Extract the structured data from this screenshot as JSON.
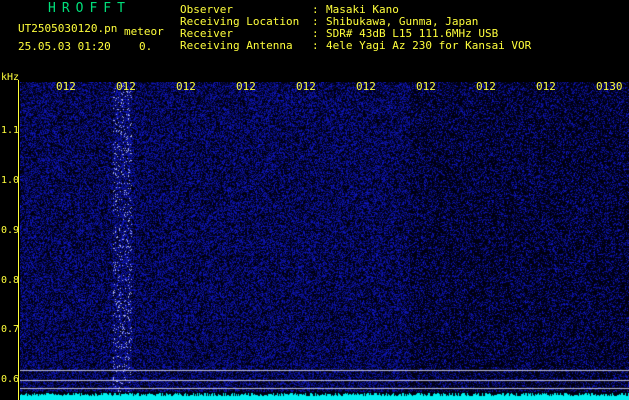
{
  "colors": {
    "title": "#00e07a",
    "text": "#ffff3c",
    "cyan": "#00f0f0",
    "bg": "#000000",
    "noise": "#1a24c8"
  },
  "header": {
    "app_title": "HROFFT",
    "filename": "UT2505030120.pn",
    "mode": "meteor",
    "date_time": "25.05.03 01:20",
    "value": "0.",
    "info": [
      {
        "label": "Observer",
        "value": "Masaki Kano"
      },
      {
        "label": "Receiving Location",
        "value": "Shibukawa, Gunma, Japan"
      },
      {
        "label": "Receiver",
        "value": "SDR# 43dB L15 111.6MHz USB"
      },
      {
        "label": "Receiving Antenna",
        "value": "4ele Yagi Az 230 for Kansai VOR"
      }
    ]
  },
  "axis": {
    "unit": "kHz",
    "time_ticks": [
      "012",
      "012",
      "012",
      "012",
      "012",
      "012",
      "012",
      "012",
      "012",
      "0130"
    ],
    "freq_ticks": [
      "1.1",
      "1.0",
      "0.9",
      "0.8",
      "0.7",
      "0.6"
    ]
  }
}
